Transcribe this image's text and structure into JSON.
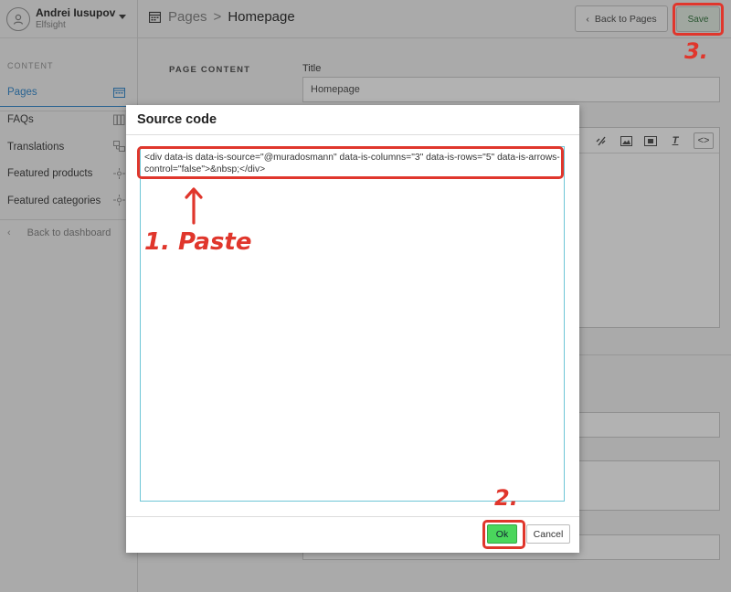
{
  "user": {
    "name": "Andrei Iusupov",
    "org": "Elfsight"
  },
  "sidebar": {
    "section_label": "CONTENT",
    "items": [
      {
        "label": "Pages",
        "icon": "calendar-icon",
        "active": true
      },
      {
        "label": "FAQs",
        "icon": "books-icon"
      },
      {
        "label": "Translations",
        "icon": "translate-icon"
      },
      {
        "label": "Featured products",
        "icon": "sparkle-icon"
      },
      {
        "label": "Featured categories",
        "icon": "sparkle-icon"
      }
    ],
    "back_label": "Back to dashboard"
  },
  "header": {
    "parent": "Pages",
    "separator": ">",
    "current": "Homepage",
    "back_button": "Back to Pages",
    "save_button": "Save"
  },
  "main": {
    "section_label": "PAGE CONTENT",
    "title_label": "Title",
    "title_value": "Homepage"
  },
  "modal": {
    "title": "Source code",
    "code": "<div data-is data-is-source=\"@muradosmann\" data-is-columns=\"3\" data-is-rows=\"5\" data-is-arrows-control=\"false\">&nbsp;</div>",
    "ok_label": "Ok",
    "cancel_label": "Cancel"
  },
  "annotations": {
    "step1": "1. Paste",
    "step2": "2.",
    "step3": "3.",
    "color": "#e0362c"
  },
  "colors": {
    "accent": "#3c8fd0",
    "ok_green": "#4ad65c",
    "save_text": "#3b7a45"
  }
}
